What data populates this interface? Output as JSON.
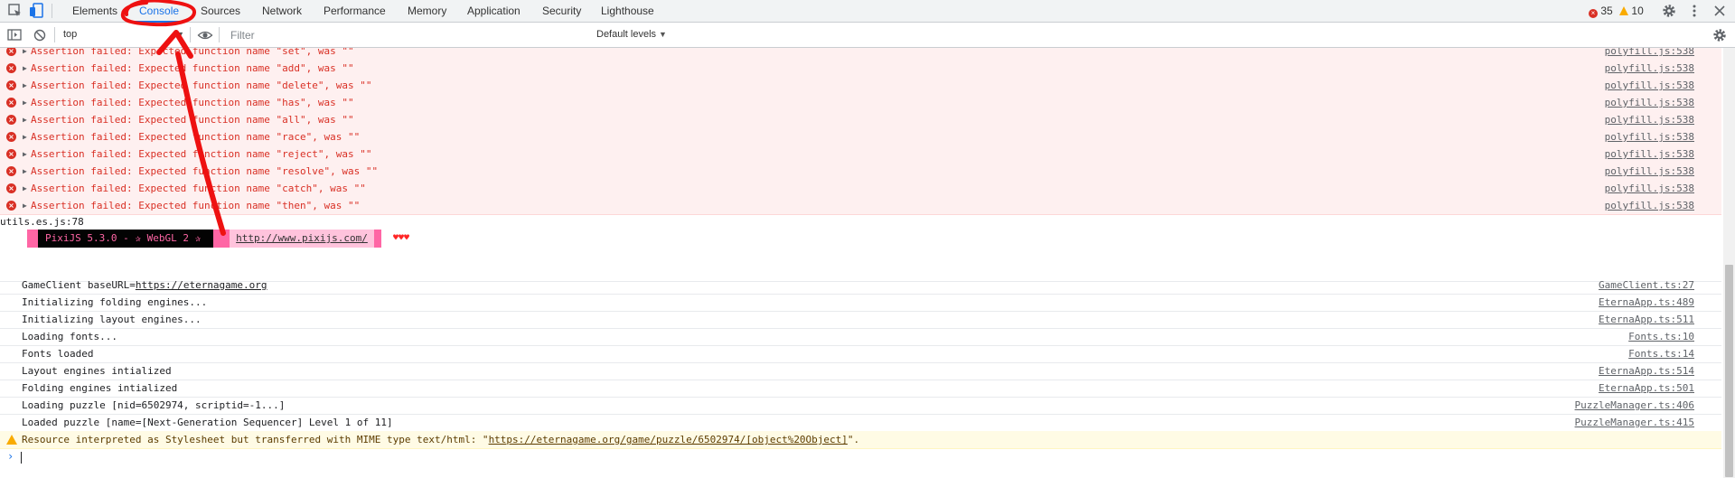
{
  "tabs": [
    {
      "label": "Elements"
    },
    {
      "label": "Console"
    },
    {
      "label": "Sources"
    },
    {
      "label": "Network"
    },
    {
      "label": "Performance"
    },
    {
      "label": "Memory"
    },
    {
      "label": "Application"
    },
    {
      "label": "Security"
    },
    {
      "label": "Lighthouse"
    }
  ],
  "counts": {
    "errors": "35",
    "warnings": "10"
  },
  "toolbar": {
    "context": "top",
    "filter_placeholder": "Filter",
    "levels": "Default levels"
  },
  "errors": [
    {
      "msg": "Assertion failed: Expected function name \"set\", was \"\"",
      "src": "polyfill.js:538"
    },
    {
      "msg": "Assertion failed: Expected function name \"add\", was \"\"",
      "src": "polyfill.js:538"
    },
    {
      "msg": "Assertion failed: Expected function name \"delete\", was \"\"",
      "src": "polyfill.js:538"
    },
    {
      "msg": "Assertion failed: Expected function name \"has\", was \"\"",
      "src": "polyfill.js:538"
    },
    {
      "msg": "Assertion failed: Expected function name \"all\", was \"\"",
      "src": "polyfill.js:538"
    },
    {
      "msg": "Assertion failed: Expected function name \"race\", was \"\"",
      "src": "polyfill.js:538"
    },
    {
      "msg": "Assertion failed: Expected function name \"reject\", was \"\"",
      "src": "polyfill.js:538"
    },
    {
      "msg": "Assertion failed: Expected function name \"resolve\", was \"\"",
      "src": "polyfill.js:538"
    },
    {
      "msg": "Assertion failed: Expected function name \"catch\", was \"\"",
      "src": "polyfill.js:538"
    },
    {
      "msg": "Assertion failed: Expected function name \"then\", was \"\"",
      "src": "polyfill.js:538"
    }
  ],
  "pixi": {
    "banner": "PixiJS 5.3.0 - ✰ WebGL 2 ✰",
    "link": "http://www.pixijs.com/",
    "hearts": "♥♥♥",
    "src": "utils.es.js:78"
  },
  "logs": [
    {
      "prefix": "GameClient baseURL=",
      "link": "https://eternagame.org",
      "src": "GameClient.ts:27"
    },
    {
      "prefix": "Initializing folding engines...",
      "link": "",
      "src": "EternaApp.ts:489"
    },
    {
      "prefix": "Initializing layout engines...",
      "link": "",
      "src": "EternaApp.ts:511"
    },
    {
      "prefix": "Loading fonts...",
      "link": "",
      "src": "Fonts.ts:10"
    },
    {
      "prefix": "Fonts loaded",
      "link": "",
      "src": "Fonts.ts:14"
    },
    {
      "prefix": "Layout engines intialized",
      "link": "",
      "src": "EternaApp.ts:514"
    },
    {
      "prefix": "Folding engines intialized",
      "link": "",
      "src": "EternaApp.ts:501"
    },
    {
      "prefix": "Loading puzzle [nid=6502974, scriptid=-1...]",
      "link": "",
      "src": "PuzzleManager.ts:406"
    },
    {
      "prefix": "Loaded puzzle [name=[Next-Generation Sequencer] Level 1 of 11]",
      "link": "",
      "src": "PuzzleManager.ts:415"
    }
  ],
  "warning": {
    "prefix": "Resource interpreted as Stylesheet but transferred with MIME type text/html: \"",
    "link": "https://eternagame.org/game/puzzle/6502974/[object%20Object]",
    "suffix": "\"."
  },
  "colors": {
    "accent": "#1a73e8",
    "error": "#d93025",
    "warning": "#f9ab00",
    "annotation": "#ee1111"
  }
}
